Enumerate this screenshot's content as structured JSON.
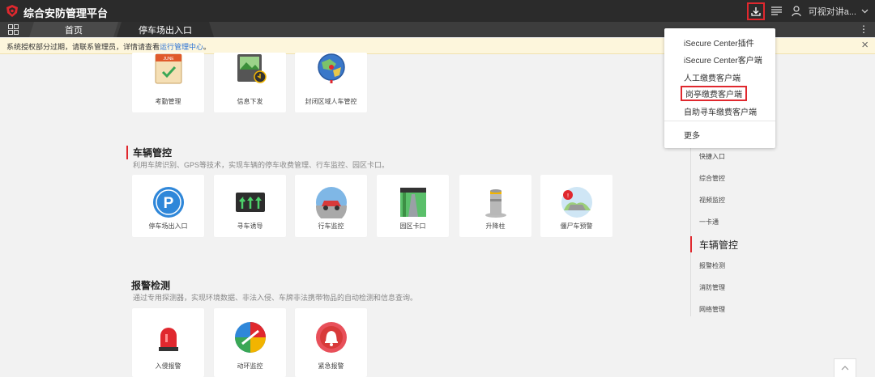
{
  "app": {
    "title": "综合安防管理平台"
  },
  "header": {
    "user_name": "可视对讲a..."
  },
  "tabs": [
    {
      "label": "首页"
    },
    {
      "label": "停车场出入口"
    }
  ],
  "notice": {
    "text": "系统授权部分过期，请联系管理员，详情请查看",
    "link": "运行管理中心",
    "suffix": "。"
  },
  "top_cards": [
    {
      "label": "考勤管理"
    },
    {
      "label": "信息下发"
    },
    {
      "label": "封闭区域人车管控"
    }
  ],
  "vehicle_section": {
    "title": "车辆管控",
    "desc": "利用车牌识别、GPS等技术，实现车辆的停车收费管理、行车监控、园区卡口。",
    "cards": [
      {
        "label": "停车场出入口"
      },
      {
        "label": "寻车诱导"
      },
      {
        "label": "行车监控"
      },
      {
        "label": "园区卡口"
      },
      {
        "label": "升降柱"
      },
      {
        "label": "僵尸车预警"
      }
    ]
  },
  "alarm_section": {
    "title": "报警检测",
    "desc": "通过专用探测器，实现环境数据、非法入侵、车牌非法携带物品的自动检测和信息查询。",
    "cards": [
      {
        "label": "入侵报警"
      },
      {
        "label": "动环监控"
      },
      {
        "label": "紧急报警"
      }
    ]
  },
  "side_nav": [
    {
      "label": "快捷入口"
    },
    {
      "label": "综合管控"
    },
    {
      "label": "视频监控"
    },
    {
      "label": "一卡通"
    },
    {
      "label": "车辆管控"
    },
    {
      "label": "报警检测"
    },
    {
      "label": "消防管理"
    },
    {
      "label": "网络管理"
    }
  ],
  "download_menu": {
    "items": [
      {
        "label": "iSecure Center插件"
      },
      {
        "label": "iSecure Center客户端"
      },
      {
        "label": "人工缴费客户端"
      },
      {
        "label": "岗亭缴费客户端"
      },
      {
        "label": "自助寻车缴费客户端"
      }
    ],
    "more": "更多"
  },
  "colors": {
    "accent": "#e0282e",
    "topbar": "#2b2b2b",
    "tabbar": "#3d3d3d",
    "link": "#2a72d5",
    "notice_bg": "#fdf6dc"
  }
}
